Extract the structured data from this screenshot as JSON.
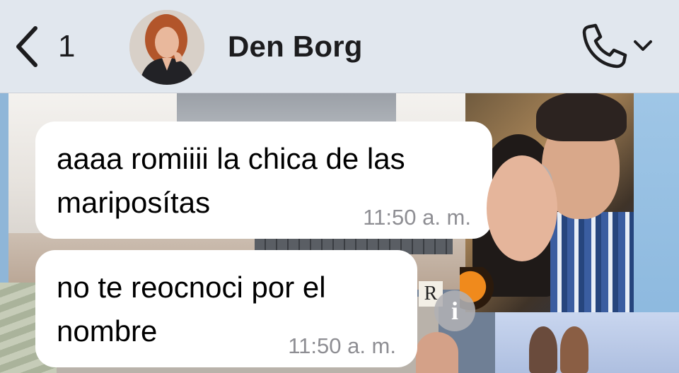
{
  "header": {
    "back_count": "1",
    "contact_name": "Den Borg",
    "back_icon": "chevron-left-icon",
    "call_icon": "phone-icon",
    "call_menu_icon": "chevron-down-icon"
  },
  "messages": [
    {
      "text": "aaaa romiiii la chica de las\nmariposítas",
      "time": "11:50 a. m.",
      "info_icon": "info-icon",
      "info_glyph": "i"
    },
    {
      "text": "no te reocnoci por el\nnombre",
      "time": "11:50 a. m.",
      "info_icon": "info-icon",
      "info_glyph": "i"
    }
  ],
  "background": {
    "r_label": "R"
  },
  "colors": {
    "header_bg": "#e5eaf1",
    "bubble_bg": "#ffffff",
    "time_text": "#8e8e93",
    "text": "#1c1c1e"
  }
}
